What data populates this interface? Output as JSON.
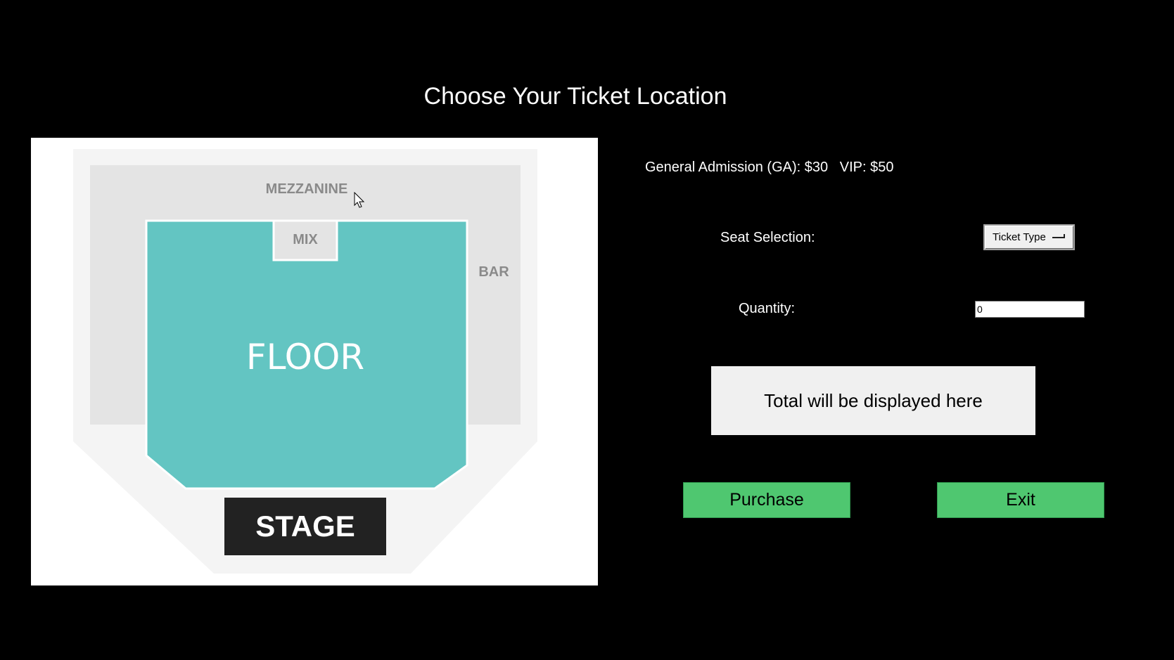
{
  "page": {
    "title": "Choose Your Ticket Location"
  },
  "seat_map": {
    "mezzanine_label": "MEZZANINE",
    "mix_label": "MIX",
    "bar_label": "BAR",
    "floor_label": "FLOOR",
    "stage_label": "STAGE",
    "colors": {
      "floor": "#63c5c2",
      "sections": "#e4e4e4",
      "outer": "#f4f4f4",
      "stage": "#222222"
    }
  },
  "pricing": {
    "text": "General Admission (GA): $30   VIP: $50"
  },
  "form": {
    "seat_selection_label": "Seat Selection:",
    "ticket_type_value": "Ticket Type",
    "quantity_label": "Quantity:",
    "quantity_value": "0"
  },
  "total": {
    "placeholder": "Total will be displayed here"
  },
  "buttons": {
    "purchase_label": "Purchase",
    "exit_label": "Exit",
    "color": "#4fc770"
  },
  "icons": {
    "cursor": "mouse-pointer-icon",
    "dropdown": "dropdown-indicator-icon"
  }
}
